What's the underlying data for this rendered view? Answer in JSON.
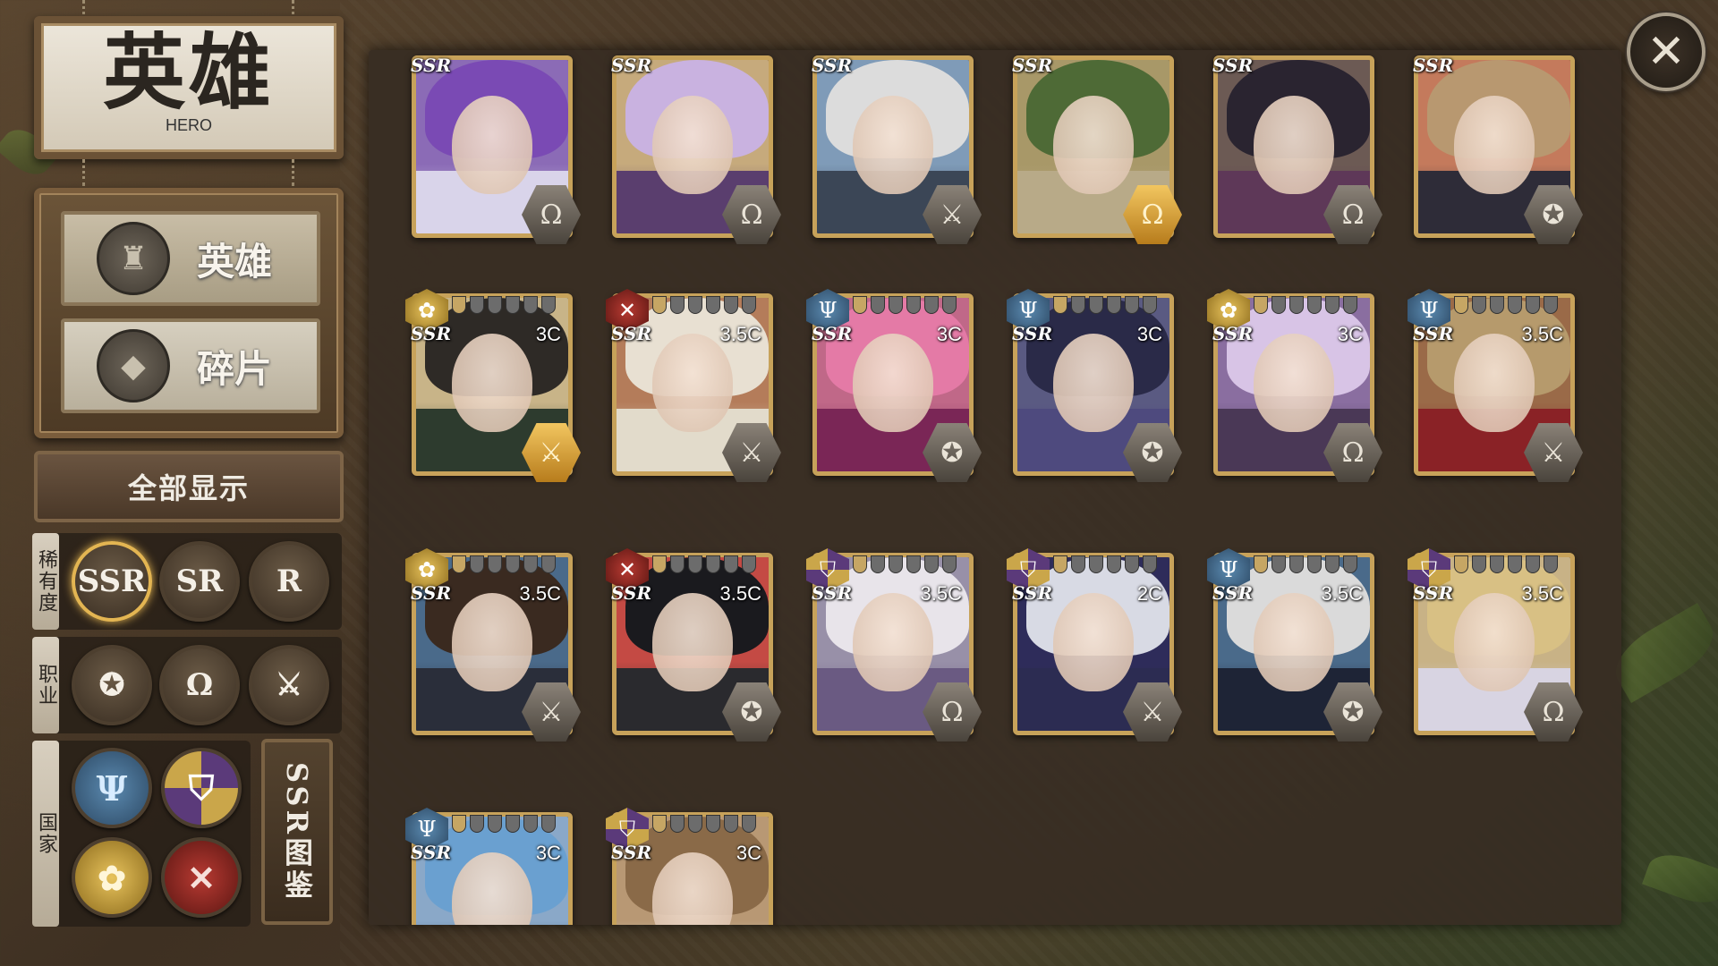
{
  "title": {
    "cn": "英雄",
    "en": "HERO"
  },
  "menu": [
    {
      "label": "英雄",
      "icon": "♜",
      "selected": true
    },
    {
      "label": "碎片",
      "icon": "◆",
      "selected": false
    }
  ],
  "show_all": "全部显示",
  "filters": {
    "rarity": {
      "label": "稀有度",
      "options": [
        "SSR",
        "SR",
        "R"
      ],
      "active": "SSR"
    },
    "class": {
      "label": "职业",
      "options": [
        {
          "name": "mage",
          "icon": "✪"
        },
        {
          "name": "support",
          "icon": "Ω"
        },
        {
          "name": "warrior",
          "icon": "⚔"
        }
      ]
    },
    "nation": {
      "label": "国家",
      "options": [
        {
          "name": "trident-nation",
          "icon": "Ψ",
          "tone": "n-blue"
        },
        {
          "name": "shield-nation",
          "icon": "⛉",
          "tone": "n-purple"
        },
        {
          "name": "flower-nation",
          "icon": "✿",
          "tone": "n-gold"
        },
        {
          "name": "swords-nation",
          "icon": "✕",
          "tone": "n-red"
        }
      ]
    },
    "codex": "SSR图鉴"
  },
  "close_icon": "✕",
  "hero_cards": [
    {
      "rarity": "SSR",
      "cost": "",
      "nation": "",
      "class": "Ω",
      "hair": "#7a4ab4",
      "outfit": "#d9d4ea",
      "bg": "#8b6bb6",
      "gold_class": false
    },
    {
      "rarity": "SSR",
      "cost": "",
      "nation": "",
      "class": "Ω",
      "hair": "#c9b2e0",
      "outfit": "#5a3e6e",
      "bg": "#c6aa7c",
      "gold_class": false
    },
    {
      "rarity": "SSR",
      "cost": "",
      "nation": "",
      "class": "⚔",
      "hair": "#dcdcdc",
      "outfit": "#3b4656",
      "bg": "#7f9bb8",
      "gold_class": false
    },
    {
      "rarity": "SSR",
      "cost": "",
      "nation": "",
      "class": "Ω",
      "hair": "#4e6a36",
      "outfit": "#b8aa88",
      "bg": "#a89868",
      "gold_class": true
    },
    {
      "rarity": "SSR",
      "cost": "",
      "nation": "",
      "class": "Ω",
      "hair": "#2a2430",
      "outfit": "#5e3858",
      "bg": "#6c5a54",
      "gold_class": false
    },
    {
      "rarity": "SSR",
      "cost": "",
      "nation": "",
      "class": "✪",
      "hair": "#b89870",
      "outfit": "#2e2c38",
      "bg": "#c47a5c",
      "gold_class": false
    },
    {
      "rarity": "SSR",
      "cost": "3C",
      "nation": "✿",
      "nation_tone": "n-gold",
      "stars": 1,
      "class": "⚔",
      "hair": "#2e2a26",
      "outfit": "#2d3b2e",
      "bg": "#c8b488",
      "gold_class": true
    },
    {
      "rarity": "SSR",
      "cost": "3.5C",
      "nation": "✕",
      "nation_tone": "n-red",
      "stars": 1,
      "class": "⚔",
      "hair": "#e8e0d2",
      "outfit": "#e2dbcb",
      "bg": "#b47c5a",
      "gold_class": false
    },
    {
      "rarity": "SSR",
      "cost": "3C",
      "nation": "Ψ",
      "nation_tone": "n-blue",
      "stars": 1,
      "class": "✪",
      "hair": "#e47aa6",
      "outfit": "#7a2656",
      "bg": "#c06888",
      "gold_class": false
    },
    {
      "rarity": "SSR",
      "cost": "3C",
      "nation": "Ψ",
      "nation_tone": "n-blue",
      "stars": 1,
      "class": "✪",
      "hair": "#2a2a48",
      "outfit": "#4e4a7e",
      "bg": "#5a5a82",
      "gold_class": false
    },
    {
      "rarity": "SSR",
      "cost": "3C",
      "nation": "✿",
      "nation_tone": "n-gold",
      "stars": 1,
      "class": "Ω",
      "hair": "#d8c4e6",
      "outfit": "#4a3856",
      "bg": "#8a6ea0",
      "gold_class": false
    },
    {
      "rarity": "SSR",
      "cost": "3.5C",
      "nation": "Ψ",
      "nation_tone": "n-blue",
      "stars": 1,
      "class": "⚔",
      "hair": "#b69a6c",
      "outfit": "#8a2226",
      "bg": "#9a6a48",
      "gold_class": false
    },
    {
      "rarity": "SSR",
      "cost": "3.5C",
      "nation": "✿",
      "nation_tone": "n-gold",
      "stars": 1,
      "class": "⚔",
      "hair": "#3a2a20",
      "outfit": "#2a2e3a",
      "bg": "#4a6a8a",
      "gold_class": false
    },
    {
      "rarity": "SSR",
      "cost": "3.5C",
      "nation": "✕",
      "nation_tone": "n-red",
      "stars": 1,
      "class": "✪",
      "hair": "#1a1a1e",
      "outfit": "#2a2a2e",
      "bg": "#c44a44",
      "gold_class": false
    },
    {
      "rarity": "SSR",
      "cost": "3.5C",
      "nation": "⛉",
      "nation_tone": "n-purple",
      "stars": 1,
      "class": "Ω",
      "hair": "#e8e4ea",
      "outfit": "#6a5a82",
      "bg": "#9890a8",
      "gold_class": false
    },
    {
      "rarity": "SSR",
      "cost": "2C",
      "nation": "⛉",
      "nation_tone": "n-purple",
      "stars": 1,
      "class": "⚔",
      "hair": "#d8dae4",
      "outfit": "#2c2c52",
      "bg": "#2e2c5a",
      "gold_class": false
    },
    {
      "rarity": "SSR",
      "cost": "3.5C",
      "nation": "Ψ",
      "nation_tone": "n-blue",
      "stars": 1,
      "class": "✪",
      "hair": "#dadada",
      "outfit": "#1e2436",
      "bg": "#4a6a8a",
      "gold_class": false
    },
    {
      "rarity": "SSR",
      "cost": "3.5C",
      "nation": "⛉",
      "nation_tone": "n-purple",
      "stars": 1,
      "class": "Ω",
      "hair": "#d8c084",
      "outfit": "#d8d4e2",
      "bg": "#c8b286",
      "gold_class": false
    },
    {
      "rarity": "SSR",
      "cost": "3C",
      "nation": "Ψ",
      "nation_tone": "n-blue",
      "stars": 1,
      "class": "",
      "hair": "#6aa0d0",
      "outfit": "#2a4a6a",
      "bg": "#8aa8c8",
      "gold_class": false
    },
    {
      "rarity": "SSR",
      "cost": "3C",
      "nation": "⛉",
      "nation_tone": "n-purple",
      "stars": 1,
      "class": "",
      "hair": "#8a6a48",
      "outfit": "#e2dcd0",
      "bg": "#b89874",
      "gold_class": false
    }
  ]
}
